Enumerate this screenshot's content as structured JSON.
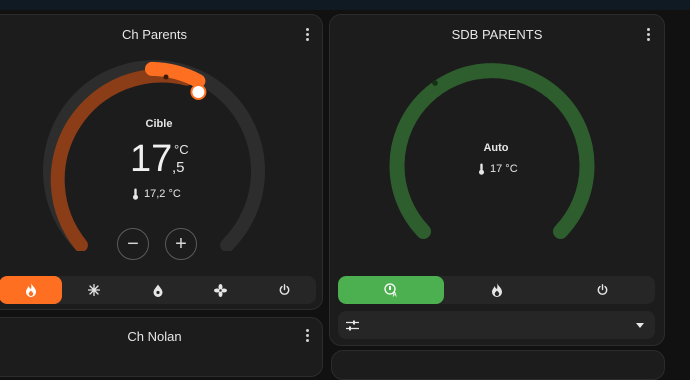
{
  "cards": {
    "left": {
      "title": "Ch Parents",
      "target_label": "Cible",
      "setpoint_int": "17",
      "setpoint_unit": "°C",
      "setpoint_dec": ",5",
      "current_temp": "17,2 °C",
      "minus_label": "−",
      "plus_label": "+",
      "modes": [
        "heat",
        "snowflake",
        "dry",
        "fan",
        "power"
      ],
      "active_mode": "heat",
      "accent_color": "#ff6f22",
      "arc_color": "#8a3d16"
    },
    "right": {
      "title": "SDB PARENTS",
      "state_label": "Auto",
      "current_temp": "17 °C",
      "modes": [
        "auto",
        "heat",
        "power"
      ],
      "active_mode": "auto",
      "accent_color": "#4caf50",
      "arc_color": "#2e5e2e"
    },
    "bottom_left": {
      "title": "Ch Nolan"
    }
  }
}
